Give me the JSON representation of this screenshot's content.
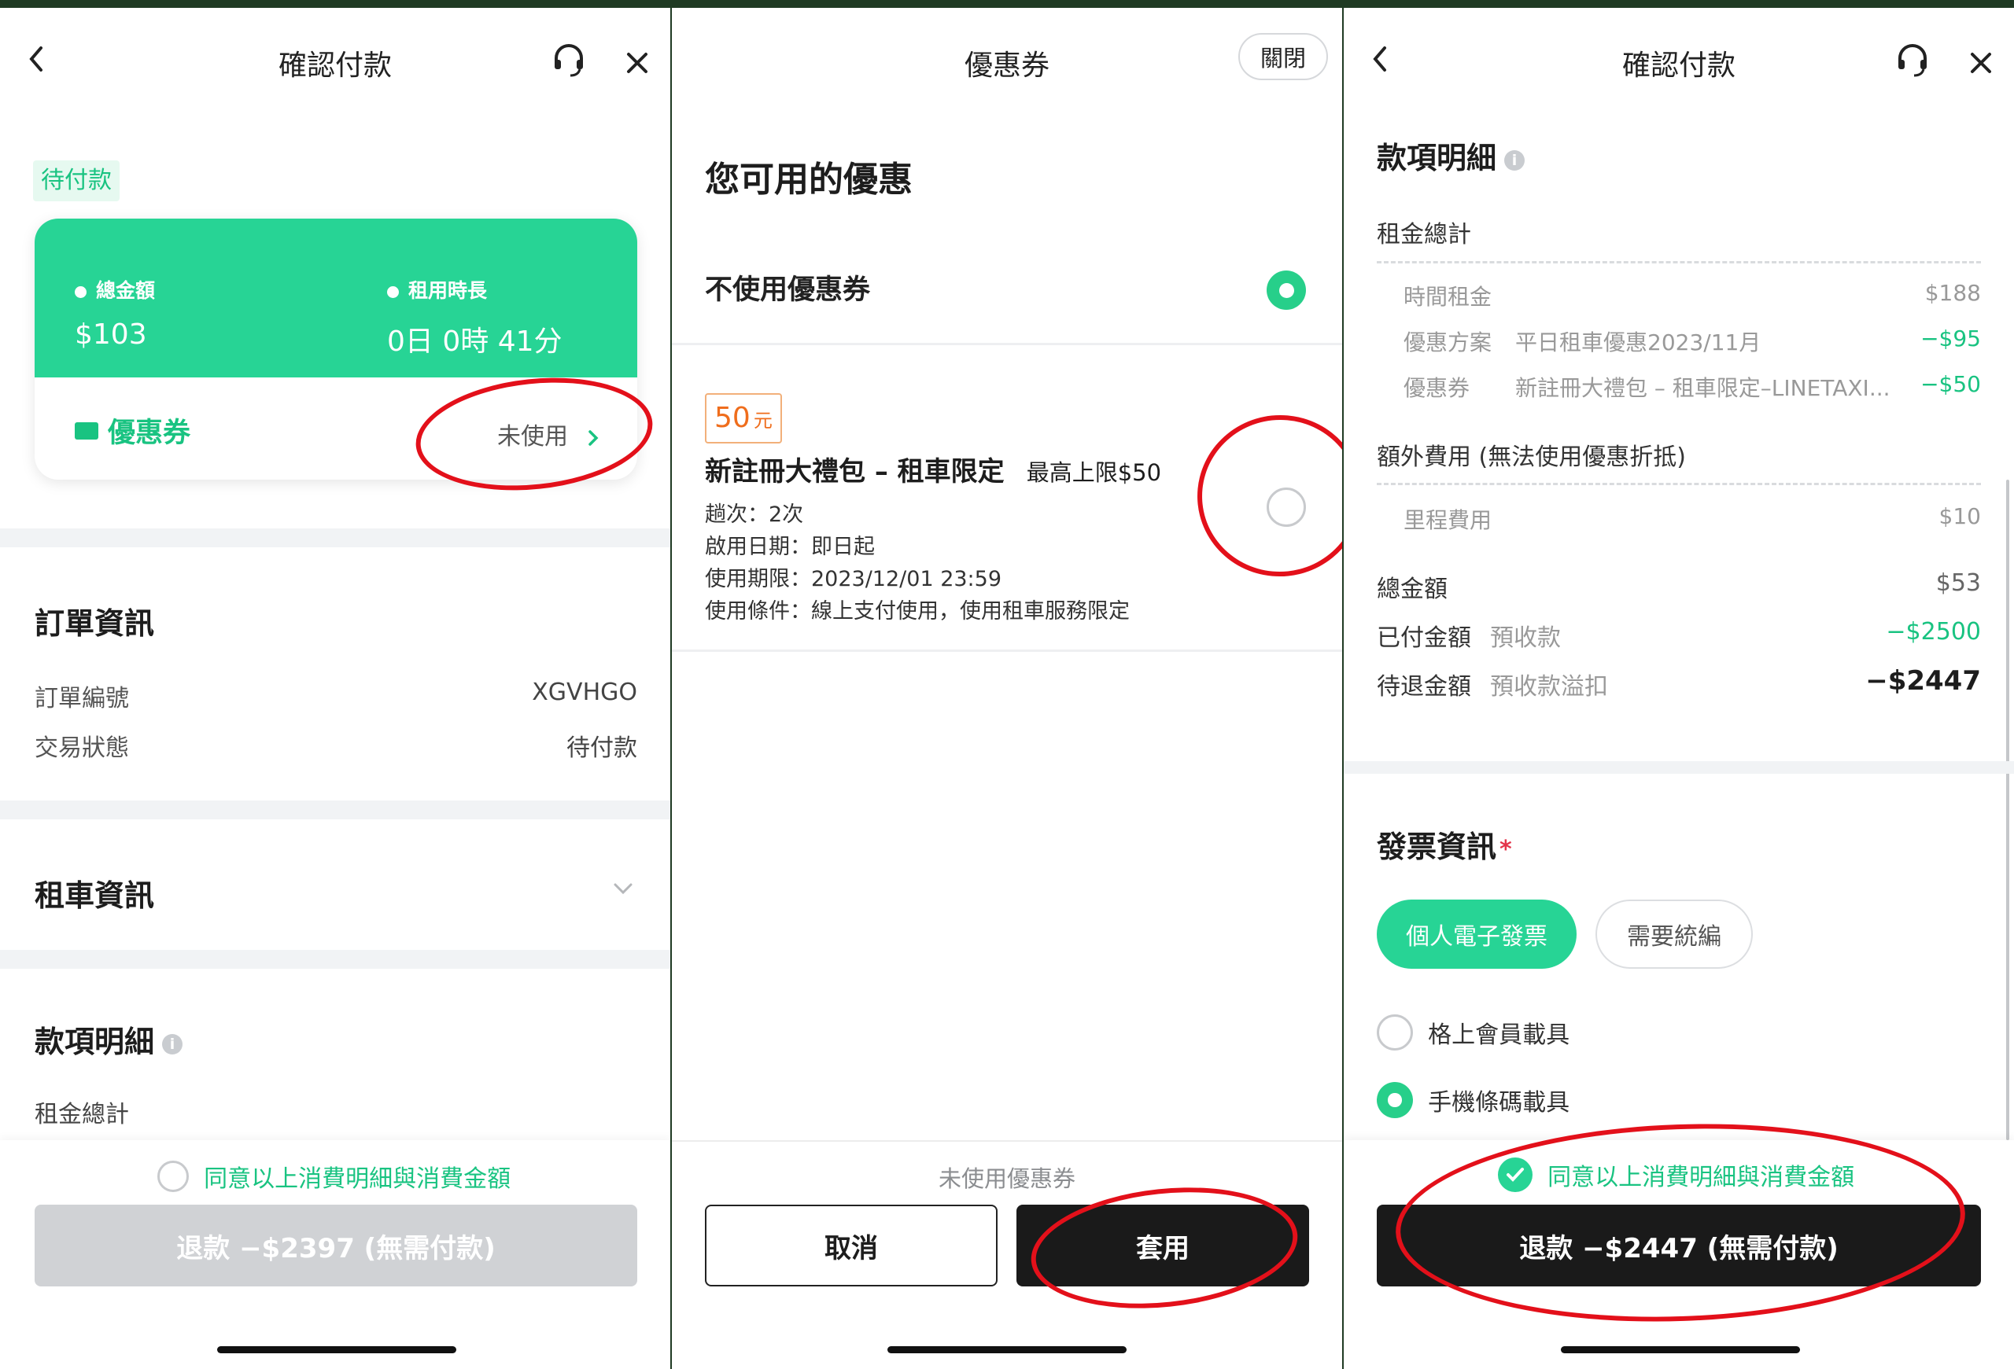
{
  "colors": {
    "accent": "#27cf8a",
    "accent_text": "#19c381",
    "dark_button": "#1a1a1a",
    "disabled_button": "#d0d2d5",
    "annotation": "#e3101a"
  },
  "panel1": {
    "title": "確認付款",
    "status_tag": "待付款",
    "card": {
      "total_label": "總金額",
      "total_value": "$103",
      "duration_label": "租用時長",
      "duration_value": "0日 0時 41分",
      "coupon_label": "優惠券",
      "coupon_value": "未使用"
    },
    "order_section": "訂單資訊",
    "order_rows": [
      {
        "label": "訂單編號",
        "value": "XGVHGO"
      },
      {
        "label": "交易狀態",
        "value": "待付款"
      }
    ],
    "rental_section": "租車資訊",
    "detail_section": "款項明細",
    "rent_total": "租金總計",
    "agree_text": "同意以上消費明細與消費金額",
    "refund_button": "退款 −$2397 (無需付款)"
  },
  "panel2": {
    "title": "優惠券",
    "close_button": "關閉",
    "heading": "您可用的優惠",
    "no_coupon": "不使用優惠券",
    "coupon": {
      "amount": "50",
      "unit": "元",
      "name": "新註冊大禮包 – 租車限定",
      "cap": "最高上限$50",
      "lines": [
        "趟次：2次",
        "啟用日期：即日起",
        "使用期限：2023/12/01 23:59",
        "使用條件：線上支付使用，使用租車服務限定"
      ]
    },
    "footer_status": "未使用優惠券",
    "cancel_button": "取消",
    "apply_button": "套用"
  },
  "panel3": {
    "title": "確認付款",
    "detail_section": "款項明細",
    "rent_total": "租金總計",
    "rent_rows": [
      {
        "label": "時間租金",
        "note": "",
        "value": "$188",
        "green": false
      },
      {
        "label": "優惠方案",
        "note": "平日租車優惠2023/11月",
        "value": "−$95",
        "green": true
      },
      {
        "label": "優惠券",
        "note": "新註冊大禮包 – 租車限定–LINETAXI...",
        "value": "−$50",
        "green": true
      }
    ],
    "extra_fee": "額外費用 (無法使用優惠折抵)",
    "mileage_label": "里程費用",
    "mileage_value": "$10",
    "total_label": "總金額",
    "total_value": "$53",
    "paid_label": "已付金額",
    "paid_note": "預收款",
    "paid_value": "−$2500",
    "refund_label": "待退金額",
    "refund_note": "預收款溢扣",
    "refund_value": "−$2447",
    "invoice_section": "發票資訊",
    "required_mark": "*",
    "invoice_personal": "個人電子發票",
    "invoice_company": "需要統編",
    "carrier_member": "格上會員載具",
    "carrier_phone": "手機條碼載具",
    "agree_text": "同意以上消費明細與消費金額",
    "refund_button": "退款 −$2447 (無需付款)"
  }
}
